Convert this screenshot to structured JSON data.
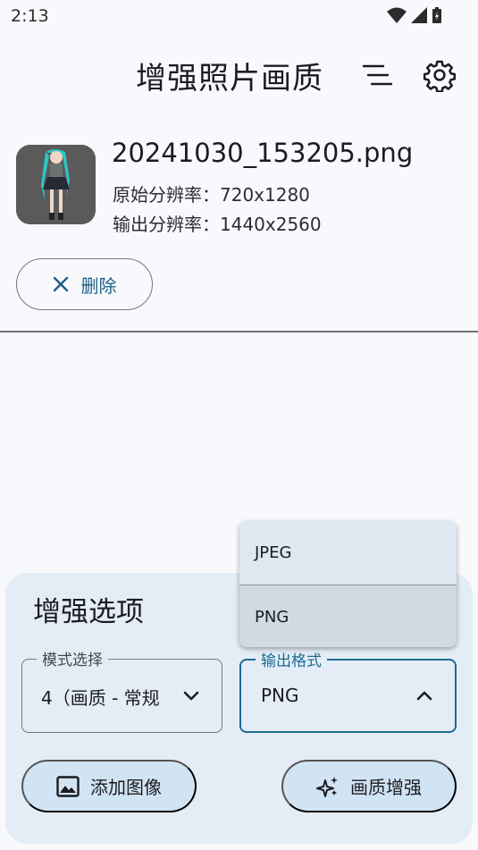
{
  "status_bar": {
    "time": "2:13"
  },
  "app_bar": {
    "title": "增强照片画质",
    "sort_icon": "sort-lines-icon",
    "settings_icon": "gear-icon"
  },
  "file": {
    "name": "20241030_153205.png",
    "original_resolution": "原始分辨率：720x1280",
    "output_resolution": "输出分辨率：1440x2560"
  },
  "delete_button": {
    "label": "删除"
  },
  "options_panel": {
    "title": "增强选项",
    "mode_field": {
      "label": "模式选择",
      "value": "4（画质 - 常规"
    },
    "format_field": {
      "label": "输出格式",
      "value": "PNG"
    },
    "add_button": {
      "label": "添加图像"
    },
    "enhance_button": {
      "label": "画质增强"
    }
  },
  "format_menu": {
    "options": [
      "JPEG",
      "PNG"
    ],
    "selected": "PNG"
  },
  "colors": {
    "accent": "#1d6c90",
    "panel": "#e4edf6",
    "pill": "#d1e4f4"
  }
}
